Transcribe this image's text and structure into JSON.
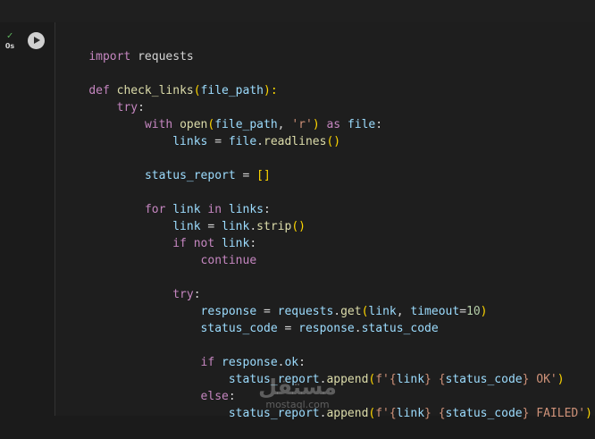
{
  "cell": {
    "exec_status": "✓",
    "exec_time": "0s",
    "run_icon": "play-icon"
  },
  "code": {
    "l1": [
      "import",
      " requests"
    ],
    "l3": [
      "def",
      " ",
      "check_links",
      "(",
      "file_path",
      "):"
    ],
    "l4": [
      "    ",
      "try",
      ":"
    ],
    "l5": [
      "        ",
      "with",
      " ",
      "open",
      "(",
      "file_path",
      ", ",
      "'r'",
      ")",
      " ",
      "as",
      " ",
      "file",
      ":"
    ],
    "l6": [
      "            ",
      "links",
      " = ",
      "file",
      ".",
      "readlines",
      "()"
    ],
    "l8": [
      "        ",
      "status_report",
      " = ",
      "[]"
    ],
    "l10": [
      "        ",
      "for",
      " ",
      "link",
      " ",
      "in",
      " ",
      "links",
      ":"
    ],
    "l11": [
      "            ",
      "link",
      " = ",
      "link",
      ".",
      "strip",
      "()"
    ],
    "l12": [
      "            ",
      "if",
      " ",
      "not",
      " ",
      "link",
      ":"
    ],
    "l13": [
      "                ",
      "continue"
    ],
    "l15": [
      "            ",
      "try",
      ":"
    ],
    "l16": [
      "                ",
      "response",
      " = ",
      "requests",
      ".",
      "get",
      "(",
      "link",
      ", ",
      "timeout",
      "=",
      "10",
      ")"
    ],
    "l17": [
      "                ",
      "status_code",
      " = ",
      "response",
      ".",
      "status_code"
    ],
    "l19": [
      "                ",
      "if",
      " ",
      "response",
      ".",
      "ok",
      ":"
    ],
    "l20": [
      "                    ",
      "status_report",
      ".",
      "append",
      "(",
      "f'",
      "{",
      "link",
      "}",
      " ",
      "{",
      "status_code",
      "}",
      " OK'",
      ")"
    ],
    "l21": [
      "                ",
      "else",
      ":"
    ],
    "l22": [
      "                    ",
      "status_report",
      ".",
      "append",
      "(",
      "f'",
      "{",
      "link",
      "}",
      " ",
      "{",
      "status_code",
      "}",
      " FAILED'",
      ")"
    ]
  },
  "watermark": {
    "arabic": "مستقل",
    "latin": "mostaql.com"
  }
}
